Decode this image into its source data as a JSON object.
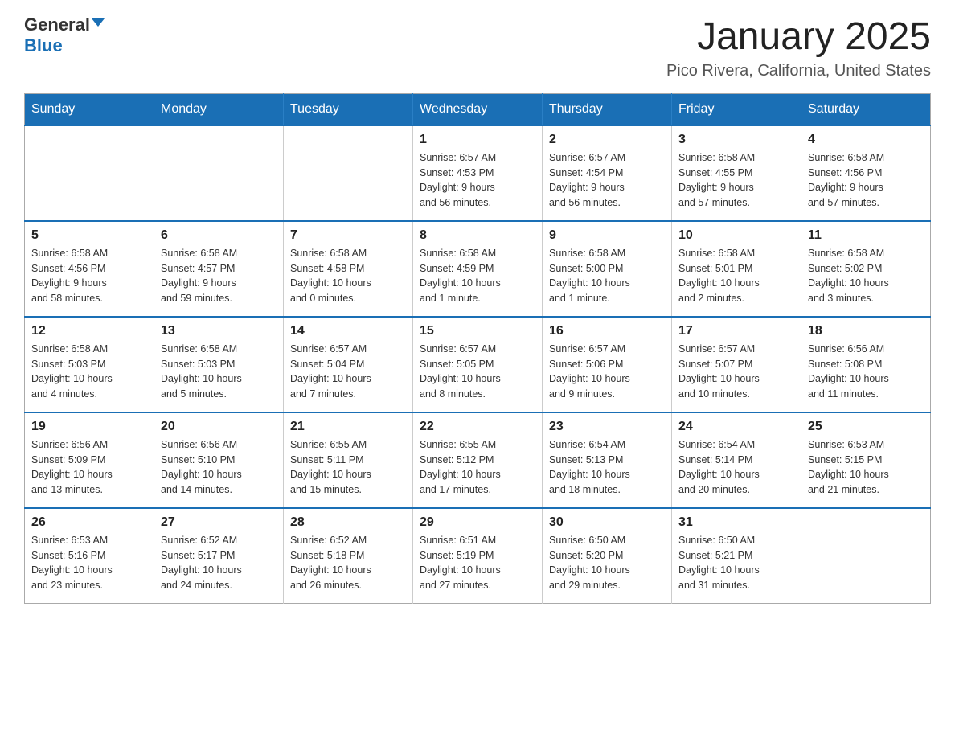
{
  "header": {
    "logo_general": "General",
    "logo_blue": "Blue",
    "month_title": "January 2025",
    "location": "Pico Rivera, California, United States"
  },
  "days_of_week": [
    "Sunday",
    "Monday",
    "Tuesday",
    "Wednesday",
    "Thursday",
    "Friday",
    "Saturday"
  ],
  "weeks": [
    [
      {
        "day": "",
        "info": ""
      },
      {
        "day": "",
        "info": ""
      },
      {
        "day": "",
        "info": ""
      },
      {
        "day": "1",
        "info": "Sunrise: 6:57 AM\nSunset: 4:53 PM\nDaylight: 9 hours\nand 56 minutes."
      },
      {
        "day": "2",
        "info": "Sunrise: 6:57 AM\nSunset: 4:54 PM\nDaylight: 9 hours\nand 56 minutes."
      },
      {
        "day": "3",
        "info": "Sunrise: 6:58 AM\nSunset: 4:55 PM\nDaylight: 9 hours\nand 57 minutes."
      },
      {
        "day": "4",
        "info": "Sunrise: 6:58 AM\nSunset: 4:56 PM\nDaylight: 9 hours\nand 57 minutes."
      }
    ],
    [
      {
        "day": "5",
        "info": "Sunrise: 6:58 AM\nSunset: 4:56 PM\nDaylight: 9 hours\nand 58 minutes."
      },
      {
        "day": "6",
        "info": "Sunrise: 6:58 AM\nSunset: 4:57 PM\nDaylight: 9 hours\nand 59 minutes."
      },
      {
        "day": "7",
        "info": "Sunrise: 6:58 AM\nSunset: 4:58 PM\nDaylight: 10 hours\nand 0 minutes."
      },
      {
        "day": "8",
        "info": "Sunrise: 6:58 AM\nSunset: 4:59 PM\nDaylight: 10 hours\nand 1 minute."
      },
      {
        "day": "9",
        "info": "Sunrise: 6:58 AM\nSunset: 5:00 PM\nDaylight: 10 hours\nand 1 minute."
      },
      {
        "day": "10",
        "info": "Sunrise: 6:58 AM\nSunset: 5:01 PM\nDaylight: 10 hours\nand 2 minutes."
      },
      {
        "day": "11",
        "info": "Sunrise: 6:58 AM\nSunset: 5:02 PM\nDaylight: 10 hours\nand 3 minutes."
      }
    ],
    [
      {
        "day": "12",
        "info": "Sunrise: 6:58 AM\nSunset: 5:03 PM\nDaylight: 10 hours\nand 4 minutes."
      },
      {
        "day": "13",
        "info": "Sunrise: 6:58 AM\nSunset: 5:03 PM\nDaylight: 10 hours\nand 5 minutes."
      },
      {
        "day": "14",
        "info": "Sunrise: 6:57 AM\nSunset: 5:04 PM\nDaylight: 10 hours\nand 7 minutes."
      },
      {
        "day": "15",
        "info": "Sunrise: 6:57 AM\nSunset: 5:05 PM\nDaylight: 10 hours\nand 8 minutes."
      },
      {
        "day": "16",
        "info": "Sunrise: 6:57 AM\nSunset: 5:06 PM\nDaylight: 10 hours\nand 9 minutes."
      },
      {
        "day": "17",
        "info": "Sunrise: 6:57 AM\nSunset: 5:07 PM\nDaylight: 10 hours\nand 10 minutes."
      },
      {
        "day": "18",
        "info": "Sunrise: 6:56 AM\nSunset: 5:08 PM\nDaylight: 10 hours\nand 11 minutes."
      }
    ],
    [
      {
        "day": "19",
        "info": "Sunrise: 6:56 AM\nSunset: 5:09 PM\nDaylight: 10 hours\nand 13 minutes."
      },
      {
        "day": "20",
        "info": "Sunrise: 6:56 AM\nSunset: 5:10 PM\nDaylight: 10 hours\nand 14 minutes."
      },
      {
        "day": "21",
        "info": "Sunrise: 6:55 AM\nSunset: 5:11 PM\nDaylight: 10 hours\nand 15 minutes."
      },
      {
        "day": "22",
        "info": "Sunrise: 6:55 AM\nSunset: 5:12 PM\nDaylight: 10 hours\nand 17 minutes."
      },
      {
        "day": "23",
        "info": "Sunrise: 6:54 AM\nSunset: 5:13 PM\nDaylight: 10 hours\nand 18 minutes."
      },
      {
        "day": "24",
        "info": "Sunrise: 6:54 AM\nSunset: 5:14 PM\nDaylight: 10 hours\nand 20 minutes."
      },
      {
        "day": "25",
        "info": "Sunrise: 6:53 AM\nSunset: 5:15 PM\nDaylight: 10 hours\nand 21 minutes."
      }
    ],
    [
      {
        "day": "26",
        "info": "Sunrise: 6:53 AM\nSunset: 5:16 PM\nDaylight: 10 hours\nand 23 minutes."
      },
      {
        "day": "27",
        "info": "Sunrise: 6:52 AM\nSunset: 5:17 PM\nDaylight: 10 hours\nand 24 minutes."
      },
      {
        "day": "28",
        "info": "Sunrise: 6:52 AM\nSunset: 5:18 PM\nDaylight: 10 hours\nand 26 minutes."
      },
      {
        "day": "29",
        "info": "Sunrise: 6:51 AM\nSunset: 5:19 PM\nDaylight: 10 hours\nand 27 minutes."
      },
      {
        "day": "30",
        "info": "Sunrise: 6:50 AM\nSunset: 5:20 PM\nDaylight: 10 hours\nand 29 minutes."
      },
      {
        "day": "31",
        "info": "Sunrise: 6:50 AM\nSunset: 5:21 PM\nDaylight: 10 hours\nand 31 minutes."
      },
      {
        "day": "",
        "info": ""
      }
    ]
  ]
}
